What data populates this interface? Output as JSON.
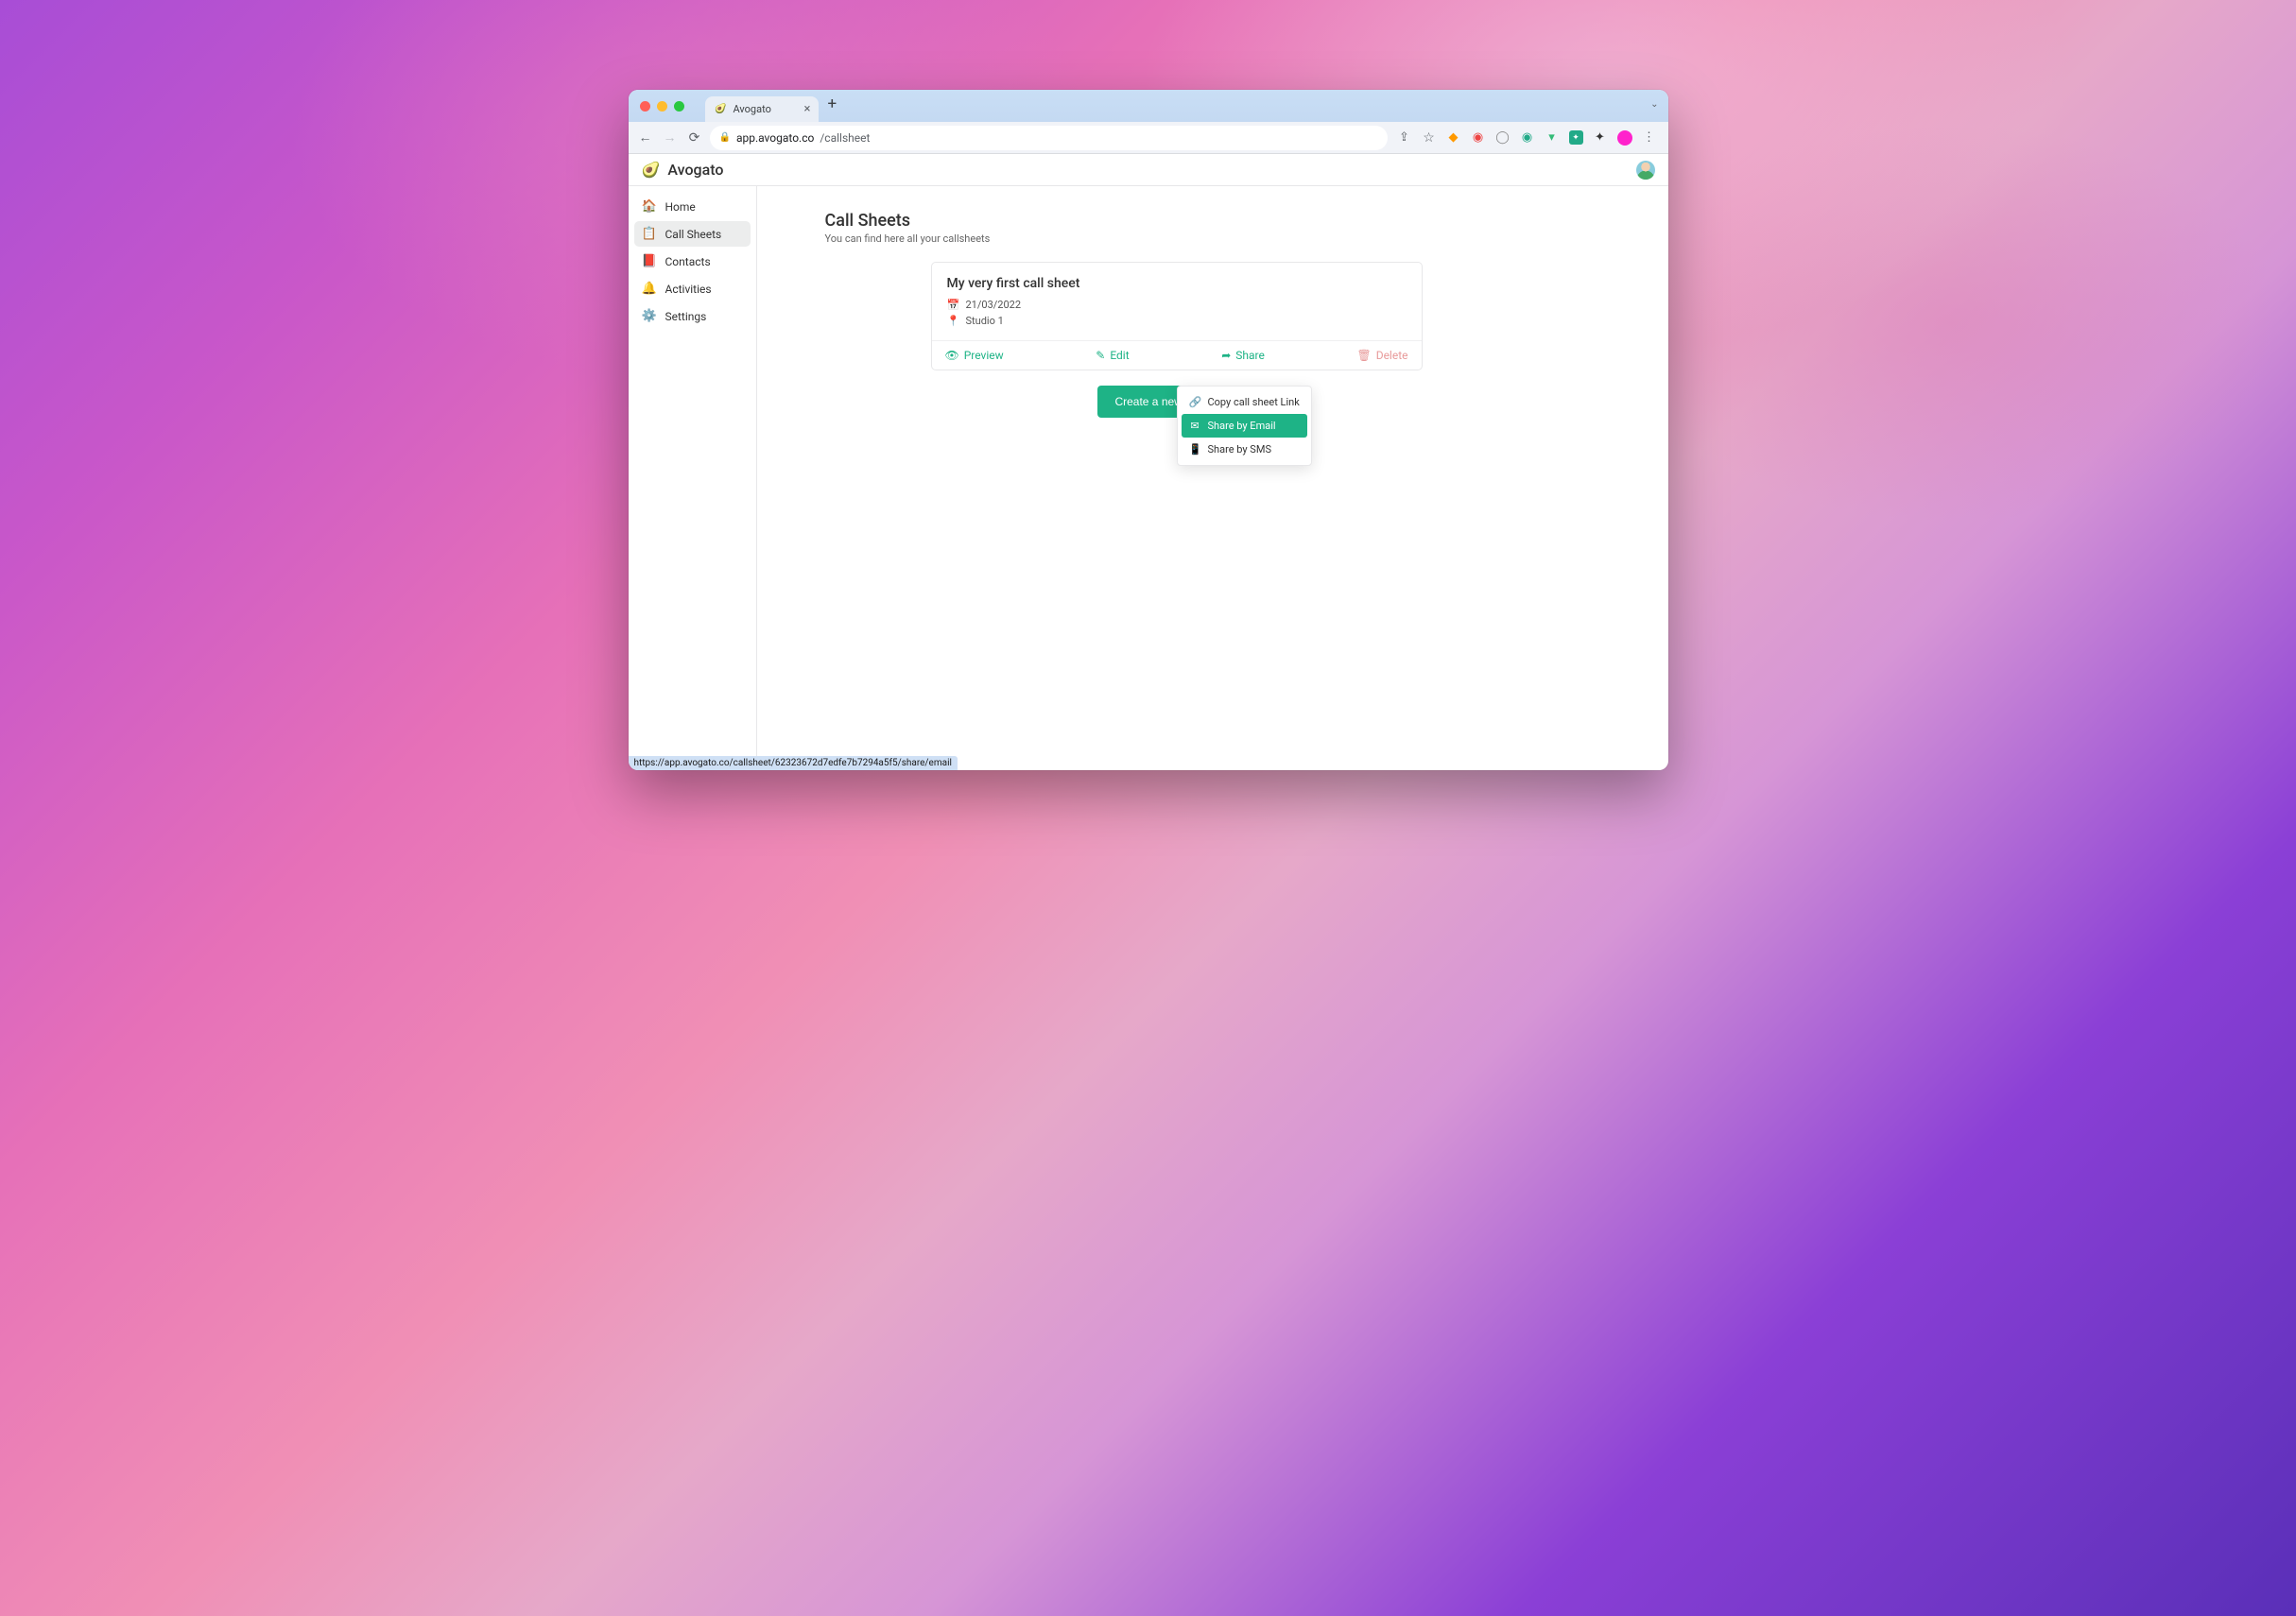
{
  "browser": {
    "tab_title": "Avogato",
    "url_host": "app.avogato.co",
    "url_path": "/callsheet",
    "status_url": "https://app.avogato.co/callsheet/62323672d7edfe7b7294a5f5/share/email"
  },
  "brand": {
    "name": "Avogato"
  },
  "sidebar": {
    "items": [
      {
        "label": "Home",
        "icon": "🏠"
      },
      {
        "label": "Call Sheets",
        "icon": "📋"
      },
      {
        "label": "Contacts",
        "icon": "📕"
      },
      {
        "label": "Activities",
        "icon": "🔔"
      },
      {
        "label": "Settings",
        "icon": "⚙️"
      }
    ]
  },
  "page": {
    "title": "Call Sheets",
    "subtitle": "You can find here all your callsheets"
  },
  "callsheet": {
    "title": "My very first call sheet",
    "date": "21/03/2022",
    "location": "Studio 1",
    "actions": {
      "preview": "Preview",
      "edit": "Edit",
      "share": "Share",
      "delete": "Delete"
    }
  },
  "create_button": "Create a new Call Sheet",
  "share_menu": {
    "copy": "Copy call sheet Link",
    "email": "Share by Email",
    "sms": "Share by SMS"
  },
  "colors": {
    "accent": "#1eb386",
    "danger": "#e89a9a"
  }
}
